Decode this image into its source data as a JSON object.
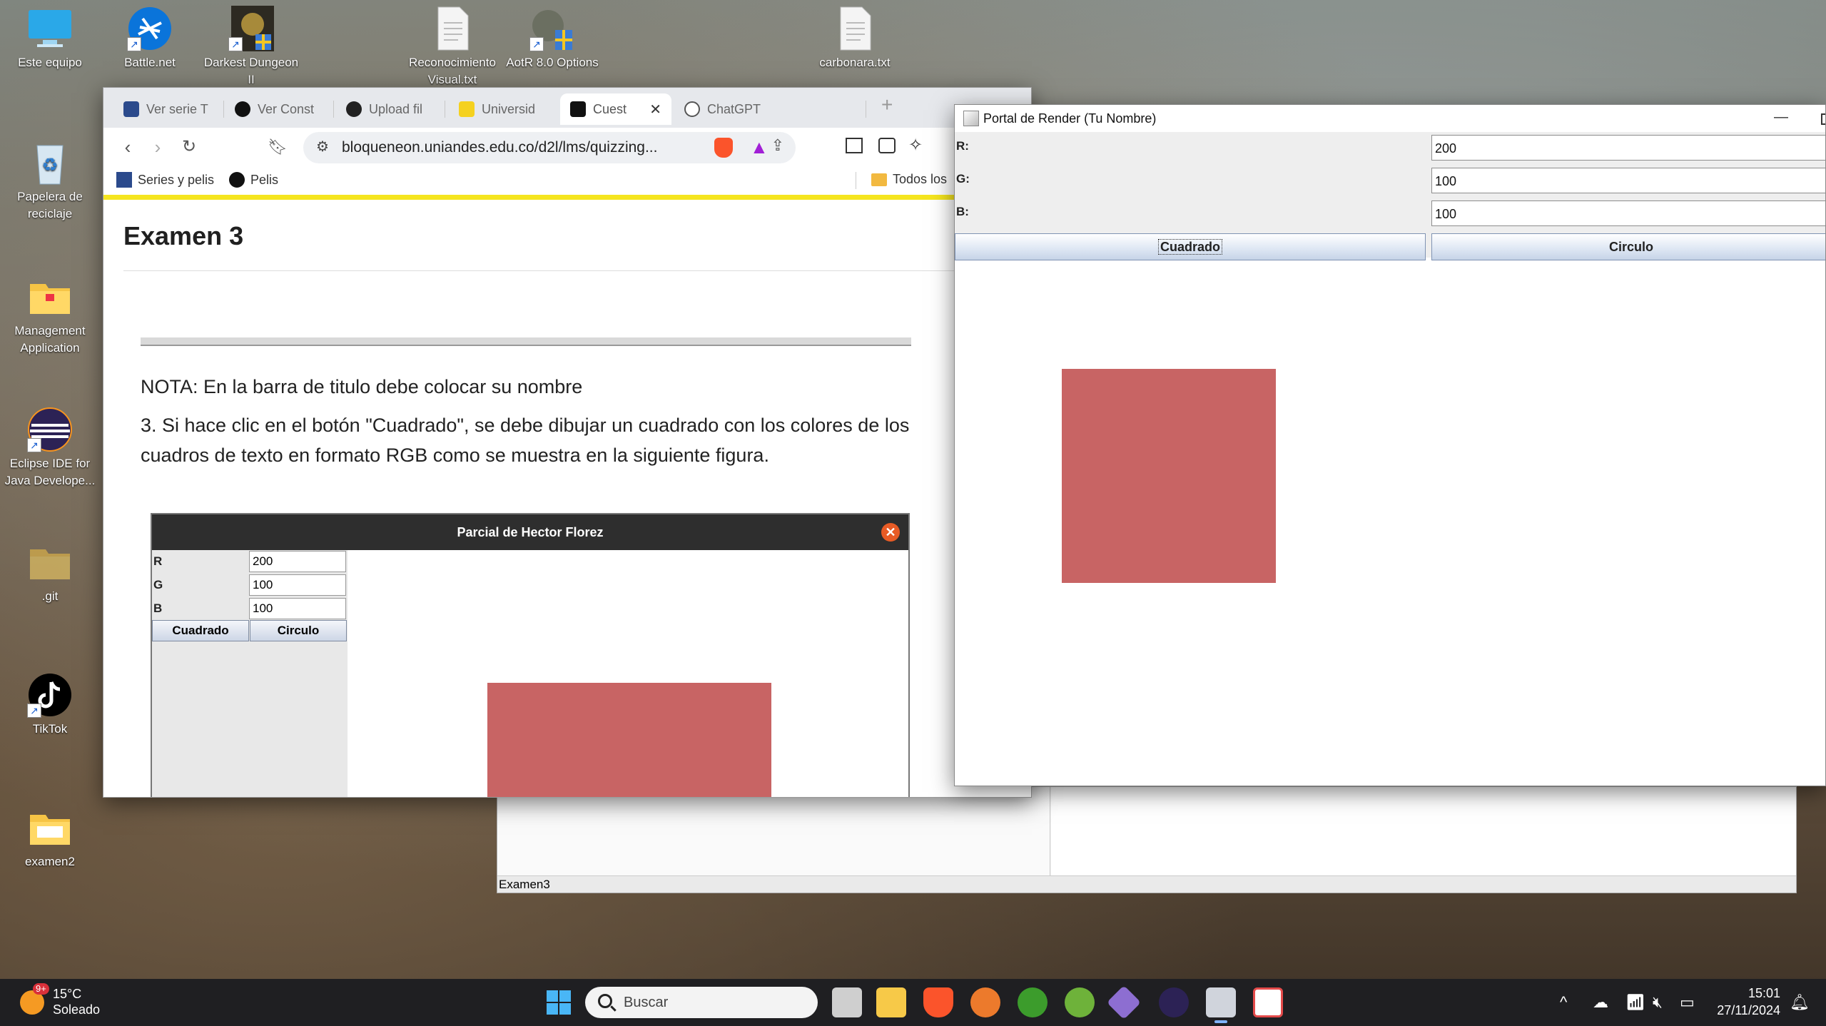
{
  "desktop": {
    "icons": [
      {
        "label": "Este equipo"
      },
      {
        "label": "Battle.net"
      },
      {
        "label": "Darkest Dungeon II"
      },
      {
        "label": "Reconocimiento Visual.txt"
      },
      {
        "label": "AotR 8.0 Options"
      },
      {
        "label": "carbonara.txt"
      },
      {
        "label": "Papelera de reciclaje"
      },
      {
        "label": "Management Application"
      },
      {
        "label": "Eclipse IDE for Java Develope..."
      },
      {
        "label": ".git"
      },
      {
        "label": "TikTok"
      },
      {
        "label": "examen2"
      }
    ]
  },
  "browser": {
    "tabs": [
      {
        "label": "Ver serie T",
        "icon": "play-icon"
      },
      {
        "label": "Ver Const",
        "icon": "triangle-icon"
      },
      {
        "label": "Upload fil",
        "icon": "github-icon"
      },
      {
        "label": "Universid",
        "icon": "shield-icon"
      },
      {
        "label": "Cuest",
        "icon": "d2l-icon",
        "active": true
      },
      {
        "label": "ChatGPT",
        "icon": "chatgpt-icon"
      }
    ],
    "new_tab": "+",
    "url": "bloqueneon.uniandes.edu.co/d2l/lms/quizzing...",
    "bookmarks": [
      {
        "label": "Series y pelis"
      },
      {
        "label": "Pelis"
      }
    ],
    "bookmarks_folder": "Todos los",
    "page_title": "Examen 3",
    "nota": "NOTA: En la barra de titulo debe colocar su nombre",
    "instruction": "3. Si hace clic en el botón \"Cuadrado\", se debe dibujar un cuadrado con los colores de los cuadros de texto en formato RGB como se muestra en la siguiente figura.",
    "example": {
      "title": "Parcial de Hector Florez",
      "rows": [
        {
          "label": "R",
          "value": "200"
        },
        {
          "label": "G",
          "value": "100"
        },
        {
          "label": "B",
          "value": "100"
        }
      ],
      "btn_square": "Cuadrado",
      "btn_circle": "Circulo",
      "square_color": "#c86464"
    }
  },
  "java_window": {
    "title": "Portal de Render (Tu Nombre)",
    "minimize": "—",
    "rows": [
      {
        "label": "R:",
        "value": "200"
      },
      {
        "label": "G:",
        "value": "100"
      },
      {
        "label": "B:",
        "value": "100"
      }
    ],
    "btn_square": "Cuadrado",
    "btn_circle": "Circulo",
    "square_color": "#c86464"
  },
  "eclipse": {
    "status": "Examen3"
  },
  "taskbar": {
    "weather_temp": "15°C",
    "weather_desc": "Soleado",
    "weather_badge": "9+",
    "search_placeholder": "Buscar",
    "time": "15:01",
    "date": "27/11/2024",
    "apps": [
      {
        "name": "windows-start-icon",
        "color": "#3aa0f3"
      },
      {
        "name": "task-view-icon",
        "color": "#d9d9d9"
      },
      {
        "name": "file-explorer-icon",
        "color": "#f7c948"
      },
      {
        "name": "brave-icon",
        "color": "#fb542b"
      },
      {
        "name": "app-orange-icon",
        "color": "#ec7a2c"
      },
      {
        "name": "xbox-icon",
        "color": "#3c9c2c"
      },
      {
        "name": "utorrent-icon",
        "color": "#6eb23a"
      },
      {
        "name": "git-icon",
        "color": "#8d6ed1"
      },
      {
        "name": "eclipse-icon",
        "color": "#2c2255"
      },
      {
        "name": "java-icon",
        "color": "#d0d4dc"
      },
      {
        "name": "snipping-icon",
        "color": "#e44a4a"
      }
    ]
  }
}
